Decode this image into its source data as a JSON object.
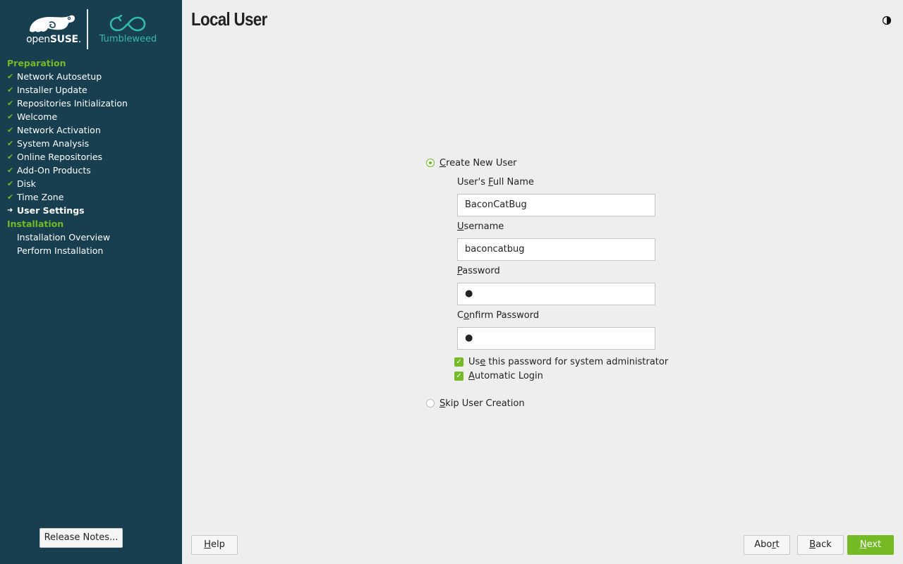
{
  "brand": {
    "logo_open": "open",
    "logo_suse": "SUSE",
    "product": "Tumbleweed",
    "colors": {
      "sidebar": "#173f4f",
      "accent_green": "#73ba25",
      "teal": "#35b9ab"
    }
  },
  "sidebar": {
    "groups": [
      {
        "title": "Preparation",
        "steps": [
          {
            "label": "Network Autosetup",
            "state": "done"
          },
          {
            "label": "Installer Update",
            "state": "done"
          },
          {
            "label": "Repositories Initialization",
            "state": "done"
          },
          {
            "label": "Welcome",
            "state": "done"
          },
          {
            "label": "Network Activation",
            "state": "done"
          },
          {
            "label": "System Analysis",
            "state": "done"
          },
          {
            "label": "Online Repositories",
            "state": "done"
          },
          {
            "label": "Add-On Products",
            "state": "done"
          },
          {
            "label": "Disk",
            "state": "done"
          },
          {
            "label": "Time Zone",
            "state": "done"
          },
          {
            "label": "User Settings",
            "state": "current"
          }
        ]
      },
      {
        "title": "Installation",
        "steps": [
          {
            "label": "Installation Overview",
            "state": "pending"
          },
          {
            "label": "Perform Installation",
            "state": "pending"
          }
        ]
      }
    ],
    "release_notes_button": "Release Notes..."
  },
  "main": {
    "title": "Local User",
    "theme_toggle_icon": "half-moon-icon",
    "create_user": {
      "label": "Create New User",
      "selected": true,
      "full_name_label": "User's Full Name",
      "full_name_value": "BaconCatBug",
      "username_label": "Username",
      "username_value": "baconcatbug",
      "password_label": "Password",
      "password_value": "●",
      "confirm_label": "Confirm Password",
      "confirm_value": "●",
      "admin_checkbox_label": "Use this password for system administrator",
      "admin_checkbox_checked": true,
      "autologin_label": "Automatic Login",
      "autologin_checked": true
    },
    "skip_user": {
      "label": "Skip User Creation",
      "selected": false
    }
  },
  "footer": {
    "help": "Help",
    "abort": "Abort",
    "back": "Back",
    "next": "Next"
  }
}
